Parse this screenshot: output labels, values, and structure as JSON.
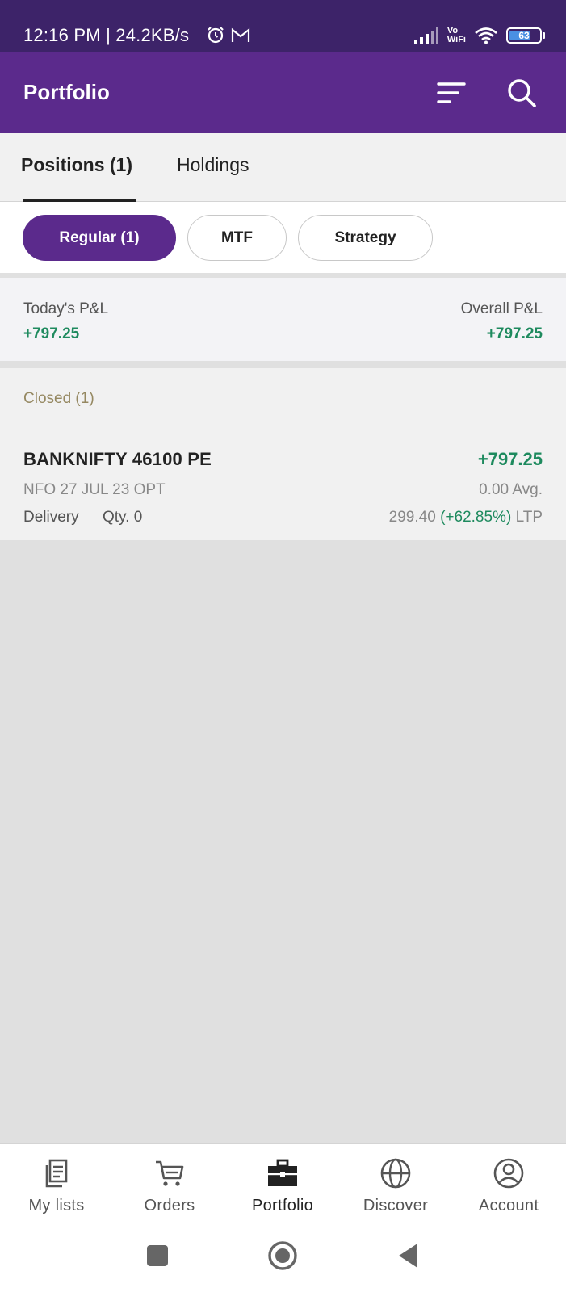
{
  "status_bar": {
    "time": "12:16 PM | 24.2KB/s",
    "battery": "63",
    "vowifi_top": "Vo",
    "vowifi_bottom": "WiFi",
    "icons": [
      "alarm-icon",
      "gmail-icon",
      "signal-icon",
      "vowifi-icon",
      "wifi-icon",
      "battery-icon"
    ]
  },
  "app_bar": {
    "title": "Portfolio",
    "icons": [
      "filter-sort-icon",
      "search-icon"
    ]
  },
  "tabs": [
    {
      "label": "Positions (1)",
      "active": true
    },
    {
      "label": "Holdings",
      "active": false
    }
  ],
  "filters": [
    {
      "label": "Regular (1)",
      "active": true
    },
    {
      "label": "MTF",
      "active": false
    },
    {
      "label": "Strategy",
      "active": false
    }
  ],
  "pnl": {
    "today_label": "Today's P&L",
    "today_value": "+797.25",
    "overall_label": "Overall P&L",
    "overall_value": "+797.25"
  },
  "closed": {
    "title": "Closed (1)",
    "position": {
      "name": "BANKNIFTY 46100 PE",
      "pnl": "+797.25",
      "subtitle": "NFO 27 JUL 23 OPT",
      "avg": "0.00 Avg.",
      "product": "Delivery",
      "qty": "Qty. 0",
      "ltp_price": "299.40",
      "ltp_change": "(+62.85%)",
      "ltp_label": "LTP"
    }
  },
  "bottom_nav": [
    {
      "label": "My lists",
      "icon": "list-icon",
      "active": false
    },
    {
      "label": "Orders",
      "icon": "cart-icon",
      "active": false
    },
    {
      "label": "Portfolio",
      "icon": "briefcase-icon",
      "active": true
    },
    {
      "label": "Discover",
      "icon": "globe-icon",
      "active": false
    },
    {
      "label": "Account",
      "icon": "user-circle-icon",
      "active": false
    }
  ],
  "system_nav": [
    "recents-button",
    "home-button",
    "back-button"
  ],
  "colors": {
    "primary": "#5b2a8c",
    "status_bar": "#3d2369",
    "profit": "#1e8a5e",
    "closed_label": "#958861"
  }
}
